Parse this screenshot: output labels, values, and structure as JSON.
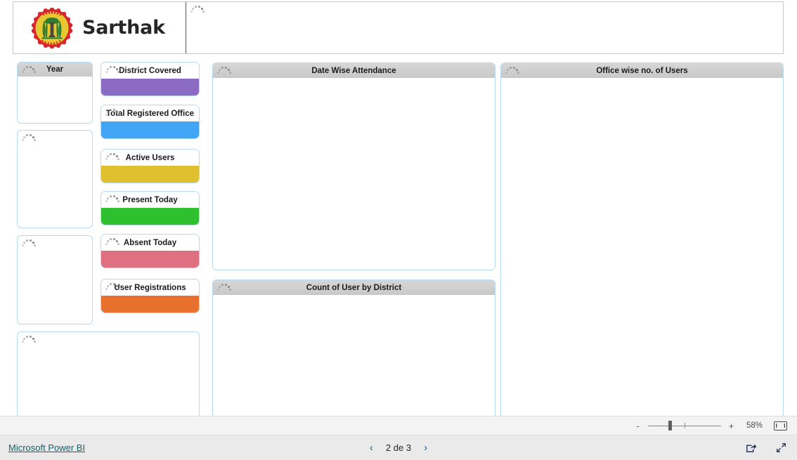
{
  "app": {
    "brand_title": "Sarthak",
    "emblem_name": "madhya-pradesh-government-emblem"
  },
  "slicers": [
    {
      "name": "year-slicer",
      "title": "Year",
      "has_title": true
    },
    {
      "name": "slicer-2",
      "title": "",
      "has_title": false
    },
    {
      "name": "slicer-3",
      "title": "",
      "has_title": false
    },
    {
      "name": "slicer-4",
      "title": "",
      "has_title": false
    }
  ],
  "kpis": [
    {
      "label": "District Covered",
      "color": "#8B6BC4"
    },
    {
      "label": "Total Registered Office",
      "color": "#42A5F5"
    },
    {
      "label": "Active Users",
      "color": "#E0C02F"
    },
    {
      "label": "Present Today",
      "color": "#2FC02F"
    },
    {
      "label": "Absent Today",
      "color": "#DE7080"
    },
    {
      "label": "User Registrations",
      "color": "#E8712E"
    }
  ],
  "charts": [
    {
      "name": "date-wise-attendance",
      "title": "Date Wise Attendance"
    },
    {
      "name": "count-of-user-by-district",
      "title": "Count of User by District"
    },
    {
      "name": "office-wise-no-of-users",
      "title": "Office wise no. of Users"
    }
  ],
  "statusbar": {
    "zoom_out_label": "-",
    "zoom_in_label": "+",
    "zoom_percent": "58%",
    "fit_icon": "fit-to-page-icon"
  },
  "footer": {
    "brand_link": "Microsoft Power BI",
    "prev_label": "‹",
    "next_label": "›",
    "page_label": "2 de 3",
    "share_icon": "share-icon",
    "fullscreen_icon": "fullscreen-icon"
  }
}
